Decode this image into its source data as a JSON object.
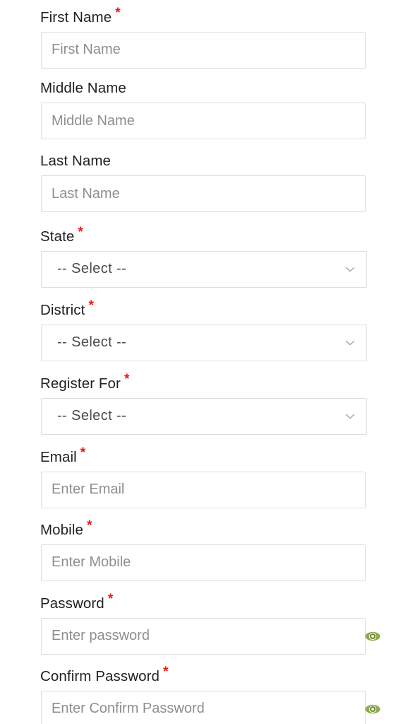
{
  "form": {
    "required_marker": "*",
    "colors": {
      "required_asterisk": "#e41b17",
      "label_text": "#202124",
      "placeholder_text": "#8f8f8f",
      "input_border": "#dedede",
      "page_background": "#ffffff",
      "eye_icon": "#7a9a3c"
    },
    "fields": [
      {
        "id": "first-name",
        "label": "First Name",
        "required": true,
        "type": "text",
        "placeholder": "First Name",
        "value": ""
      },
      {
        "id": "middle-name",
        "label": "Middle Name",
        "required": false,
        "type": "text",
        "placeholder": "Middle Name",
        "value": ""
      },
      {
        "id": "last-name",
        "label": "Last Name",
        "required": false,
        "type": "text",
        "placeholder": "Last Name",
        "value": ""
      },
      {
        "id": "state",
        "label": "State",
        "required": true,
        "type": "select",
        "selected": "-- Select --",
        "icon": "chevron-down-icon"
      },
      {
        "id": "district",
        "label": "District",
        "required": true,
        "type": "select",
        "selected": "-- Select --",
        "icon": "chevron-down-icon"
      },
      {
        "id": "register-for",
        "label": "Register For",
        "required": true,
        "type": "select",
        "selected": "-- Select --",
        "icon": "chevron-down-icon"
      },
      {
        "id": "email",
        "label": "Email",
        "required": true,
        "type": "email",
        "placeholder": "Enter Email",
        "value": ""
      },
      {
        "id": "mobile",
        "label": "Mobile",
        "required": true,
        "type": "tel",
        "placeholder": "Enter Mobile",
        "value": ""
      },
      {
        "id": "password",
        "label": "Password",
        "required": true,
        "type": "password",
        "placeholder": "Enter password",
        "value": "",
        "icon": "eye-icon"
      },
      {
        "id": "confirm-password",
        "label": "Confirm Password",
        "required": true,
        "type": "password",
        "placeholder": "Enter Confirm Password",
        "value": "",
        "icon": "eye-icon"
      }
    ]
  }
}
